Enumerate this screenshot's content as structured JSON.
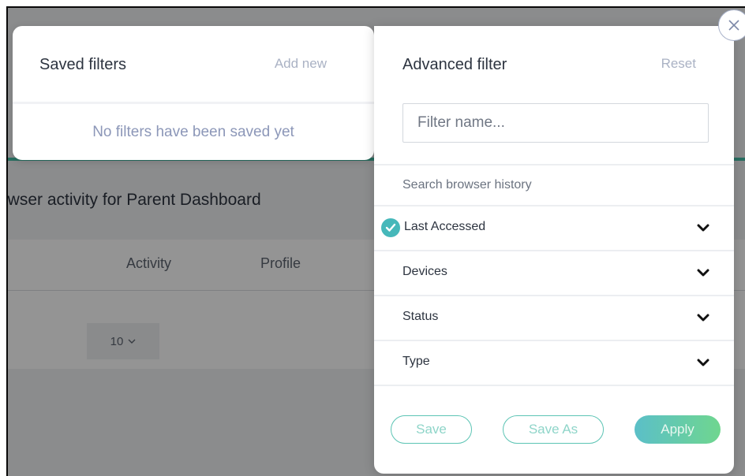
{
  "background": {
    "page_title": "owser activity for Parent Dashboard",
    "columns": [
      "Activity",
      "Profile"
    ],
    "pager_value": "10",
    "accent": "#46bfa8"
  },
  "saved_filters": {
    "title": "Saved filters",
    "add_new_label": "Add new",
    "empty_message": "No filters have been saved yet"
  },
  "advanced_filter": {
    "title": "Advanced filter",
    "reset_label": "Reset",
    "name_placeholder": "Filter name...",
    "section_label": "Search browser history",
    "rows": [
      {
        "label": "Last Accessed",
        "checked": true,
        "icon": "chevron-down-icon"
      },
      {
        "label": "Devices",
        "checked": false,
        "icon": "chevron-down-icon"
      },
      {
        "label": "Status",
        "checked": false,
        "icon": "chevron-down-icon"
      },
      {
        "label": "Type",
        "checked": false,
        "icon": "chevron-down-icon"
      }
    ],
    "buttons": {
      "save_label": "Save",
      "save_as_label": "Save As",
      "apply_label": "Apply"
    }
  },
  "colors": {
    "teal": "#46b8ba",
    "button_outline": "#5cc4b4",
    "apply_gradient_start": "#5bbfc8",
    "apply_gradient_end": "#6fd68f",
    "muted_link": "#aab2c4"
  },
  "icons": {
    "close": "close-icon",
    "check": "check-circle-icon",
    "chevron": "chevron-down-icon",
    "pager_caret": "caret-down-icon"
  }
}
